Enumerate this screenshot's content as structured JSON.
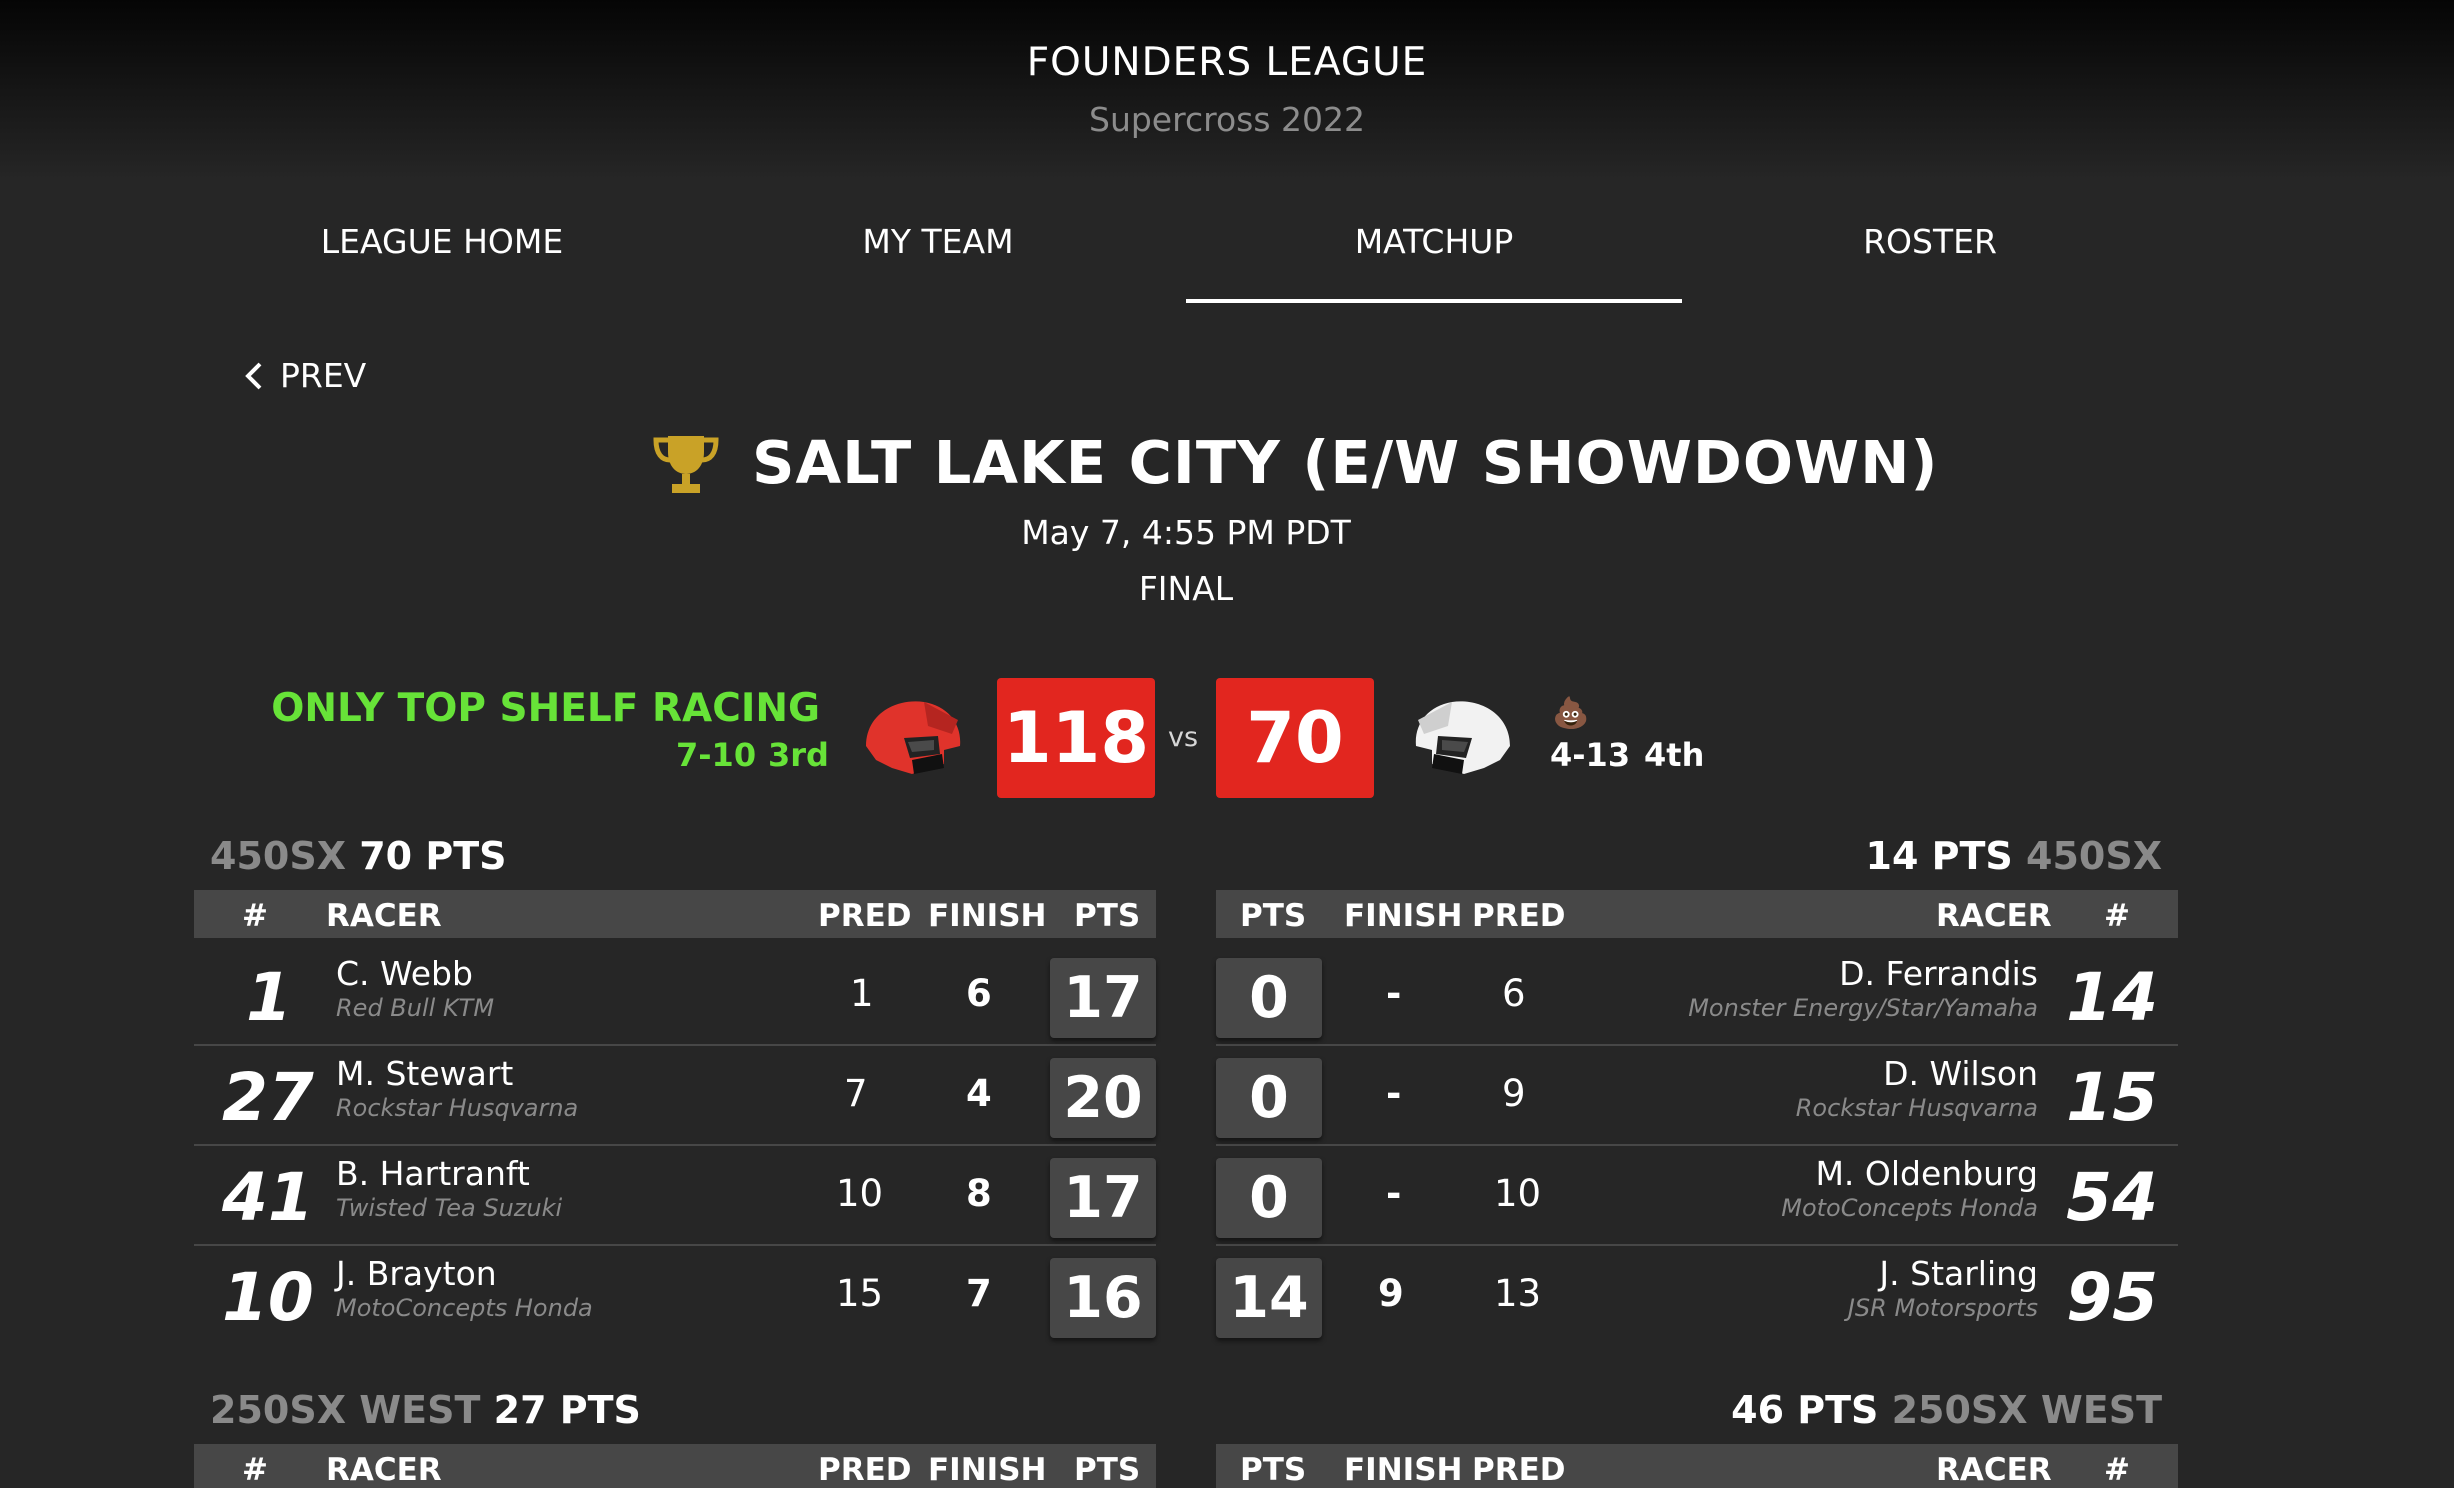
{
  "league": {
    "name": "FOUNDERS LEAGUE",
    "season": "Supercross 2022"
  },
  "nav": {
    "tabs": [
      "LEAGUE HOME",
      "MY TEAM",
      "MATCHUP",
      "ROSTER"
    ],
    "active": "MATCHUP"
  },
  "prev_label": "PREV",
  "event": {
    "title": "SALT LAKE CITY (E/W SHOWDOWN)",
    "date": "May 7, 4:55 PM PDT",
    "status": "FINAL"
  },
  "matchup": {
    "home": {
      "name": "ONLY TOP SHELF RACING",
      "record": "7-10",
      "rank": "3rd",
      "score": "118",
      "helmet_color": "#e0332b"
    },
    "vs": "vs",
    "away": {
      "record": "4-13",
      "rank": "4th",
      "score": "70",
      "helmet_color": "#f2f2f2",
      "emoji": "💩"
    }
  },
  "columns": {
    "num": "#",
    "racer": "RACER",
    "pred": "PRED",
    "finish": "FINISH",
    "pts": "PTS"
  },
  "classes": [
    {
      "name": "450SX",
      "home_pts": "70 PTS",
      "away_pts": "14 PTS",
      "home_rows": [
        {
          "num": "1",
          "name": "C. Webb",
          "team": "Red Bull KTM",
          "pred": "1",
          "finish": "6",
          "pts": "17"
        },
        {
          "num": "27",
          "name": "M. Stewart",
          "team": "Rockstar Husqvarna",
          "pred": "7",
          "finish": "4",
          "pts": "20"
        },
        {
          "num": "41",
          "name": "B. Hartranft",
          "team": "Twisted Tea Suzuki",
          "pred": "10",
          "finish": "8",
          "pts": "17"
        },
        {
          "num": "10",
          "name": "J. Brayton",
          "team": "MotoConcepts Honda",
          "pred": "15",
          "finish": "7",
          "pts": "16"
        }
      ],
      "away_rows": [
        {
          "pts": "0",
          "finish": "-",
          "pred": "6",
          "name": "D. Ferrandis",
          "team": "Monster Energy/Star/Yamaha",
          "num": "14"
        },
        {
          "pts": "0",
          "finish": "-",
          "pred": "9",
          "name": "D. Wilson",
          "team": "Rockstar Husqvarna",
          "num": "15"
        },
        {
          "pts": "0",
          "finish": "-",
          "pred": "10",
          "name": "M. Oldenburg",
          "team": "MotoConcepts Honda",
          "num": "54"
        },
        {
          "pts": "14",
          "finish": "9",
          "pred": "13",
          "name": "J. Starling",
          "team": "JSR Motorsports",
          "num": "95"
        }
      ]
    },
    {
      "name": "250SX WEST",
      "home_pts": "27 PTS",
      "away_pts": "46 PTS"
    }
  ],
  "colors": {
    "accent_green": "#67e338",
    "score_red": "#e2261f",
    "trophy_gold": "#c9a227",
    "background": "#262626",
    "header_bar": "#474747"
  }
}
